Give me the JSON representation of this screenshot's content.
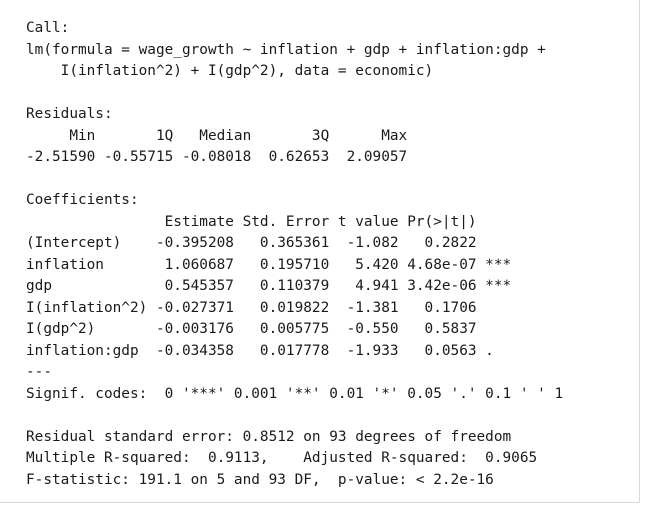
{
  "output": {
    "lines": [
      "Call:",
      "lm(formula = wage_growth ~ inflation + gdp + inflation:gdp +",
      "    I(inflation^2) + I(gdp^2), data = economic)",
      "",
      "Residuals:",
      "     Min       1Q   Median       3Q      Max ",
      "-2.51590 -0.55715 -0.08018  0.62653  2.09057 ",
      "",
      "Coefficients:",
      "                Estimate Std. Error t value Pr(>|t|)    ",
      "(Intercept)    -0.395208   0.365361  -1.082   0.2822    ",
      "inflation       1.060687   0.195710   5.420 4.68e-07 ***",
      "gdp             0.545357   0.110379   4.941 3.42e-06 ***",
      "I(inflation^2) -0.027371   0.019822  -1.381   0.1706    ",
      "I(gdp^2)       -0.003176   0.005775  -0.550   0.5837    ",
      "inflation:gdp  -0.034358   0.017778  -1.933   0.0563 .  ",
      "---",
      "Signif. codes:  0 '***' 0.001 '**' 0.01 '*' 0.05 '.' 0.1 ' ' 1",
      "",
      "Residual standard error: 0.8512 on 93 degrees of freedom",
      "Multiple R-squared:  0.9113,    Adjusted R-squared:  0.9065 ",
      "F-statistic: 191.1 on 5 and 93 DF,  p-value: < 2.2e-16"
    ]
  }
}
